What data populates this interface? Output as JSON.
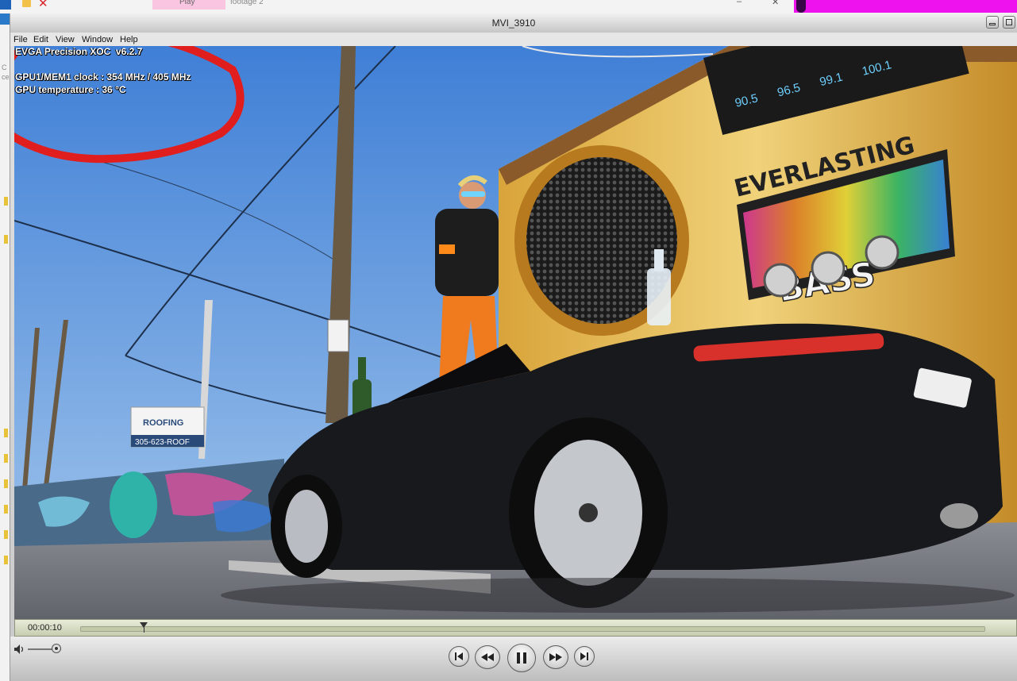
{
  "background": {
    "tab_1_label": "Play",
    "tab_2_label": "footage 2",
    "left_fragments": [
      "C",
      "ce"
    ]
  },
  "window": {
    "title": "MVI_3910"
  },
  "menu": {
    "items": [
      "File",
      "Edit",
      "View",
      "Window",
      "Help"
    ]
  },
  "osd": {
    "line_1": "EVGA Precision XOC  v6.2.7",
    "line_2": "GPU1/MEM1 clock : 354 MHz / 405 MHz",
    "line_3": "GPU temperature : 36 °C"
  },
  "video_scene": {
    "mural_text_main": "EVERLASTING",
    "mural_text_bass": "BASS",
    "radio_dial_numbers": [
      "90.5",
      "96.5",
      "99.1",
      "100.1"
    ],
    "billboard_brand": "ROOFING",
    "billboard_phone": "305-623-ROOF"
  },
  "transport": {
    "current_time": "00:00:10",
    "playhead_fraction": 0.07,
    "volume_fraction": 0.85
  },
  "colors": {
    "annotation_circle": "#e01e1e",
    "sky": "#5c92d8",
    "timeline_bg": "#d5dbbf"
  },
  "icons": [
    "volume-icon",
    "skip-back-icon",
    "rewind-icon",
    "pause-icon",
    "fast-forward-icon",
    "skip-forward-icon"
  ]
}
